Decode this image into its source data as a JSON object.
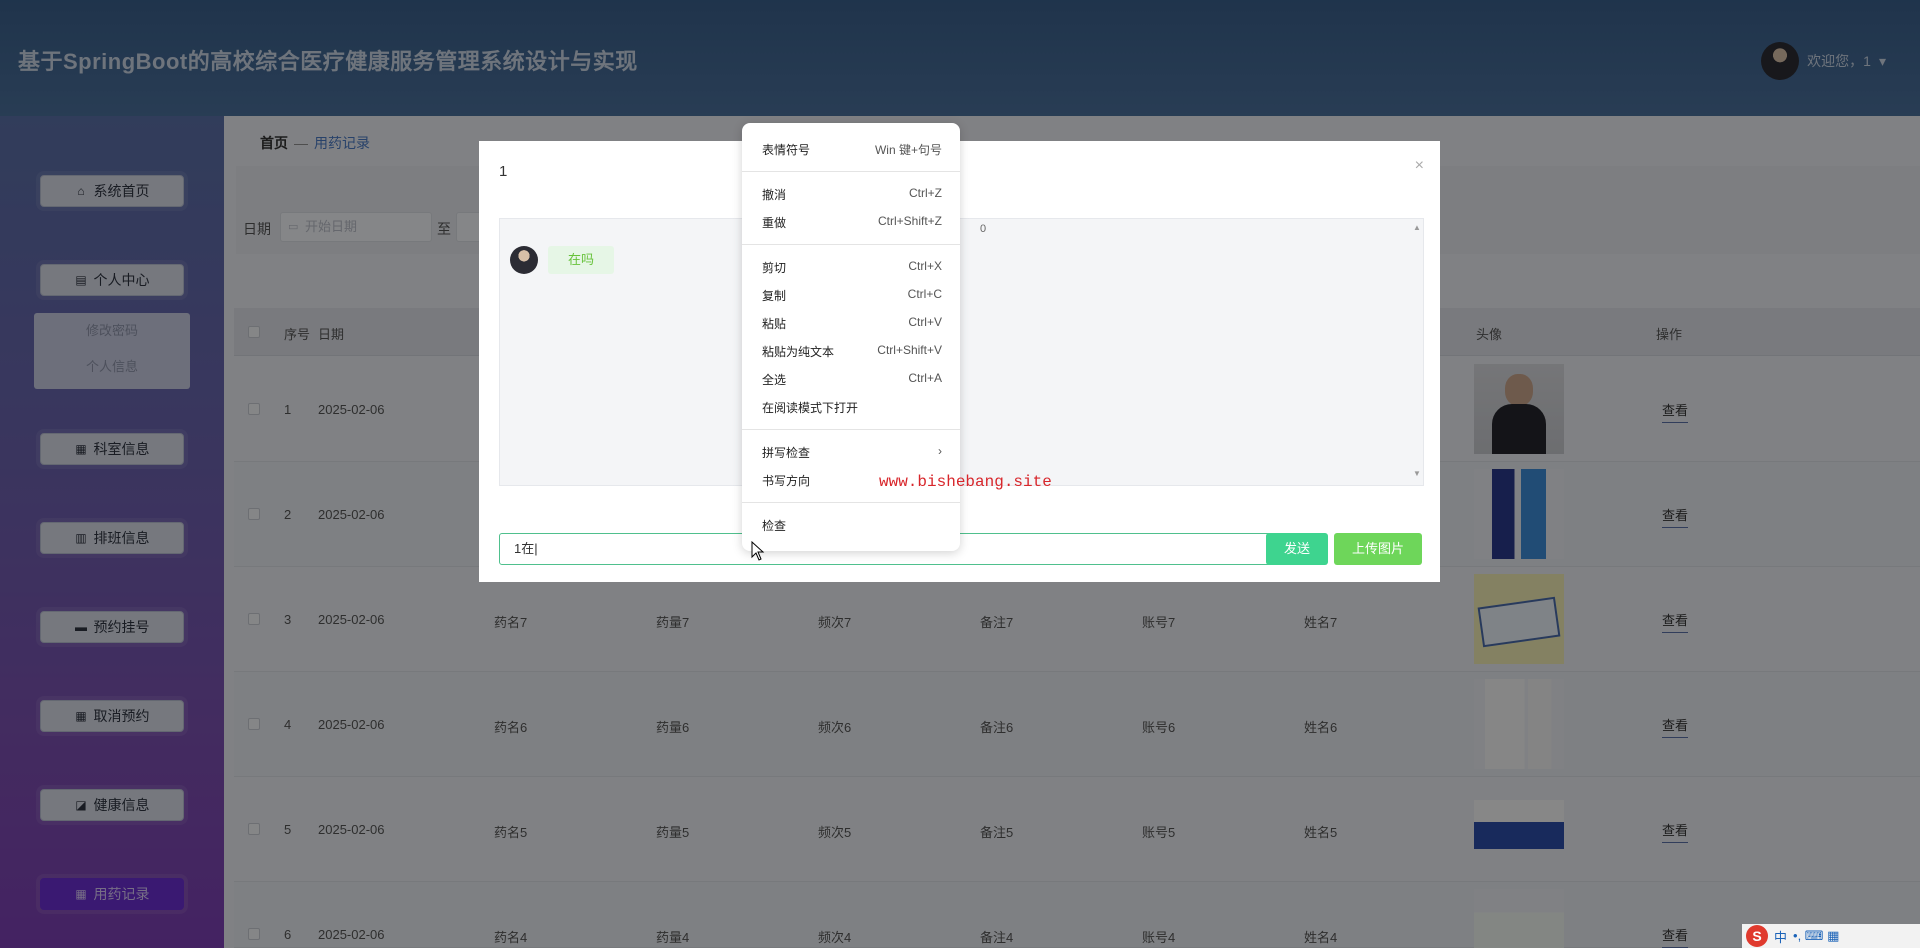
{
  "header": {
    "title": "基于SpringBoot的高校综合医疗健康服务管理系统设计与实现",
    "welcome": "欢迎您，1",
    "dropdown_icon": "▾"
  },
  "sidebar": {
    "items": [
      {
        "label": "系统首页",
        "icon": "⌂"
      },
      {
        "label": "个人中心",
        "icon": "▤"
      },
      {
        "label": "科室信息",
        "icon": "▦"
      },
      {
        "label": "排班信息",
        "icon": "▥"
      },
      {
        "label": "预约挂号",
        "icon": "▬"
      },
      {
        "label": "取消预约",
        "icon": "▦"
      },
      {
        "label": "健康信息",
        "icon": "◪"
      },
      {
        "label": "用药记录",
        "icon": "▦"
      }
    ],
    "submenu": [
      "修改密码",
      "个人信息"
    ]
  },
  "breadcrumb": {
    "home": "首页",
    "sep": "—",
    "current": "用药记录"
  },
  "search": {
    "date_label": "日期",
    "date_placeholder": "开始日期",
    "to_label": "至"
  },
  "table": {
    "headers": {
      "index": "序号",
      "date": "日期",
      "avatar": "头像",
      "action": "操作"
    },
    "rows": [
      {
        "index": "1",
        "date": "2025-02-06",
        "name": "",
        "dose": "",
        "freq": "",
        "note": "",
        "account": "",
        "person": ""
      },
      {
        "index": "2",
        "date": "2025-02-06",
        "name": "",
        "dose": "",
        "freq": "",
        "note": "",
        "account": "",
        "person": ""
      },
      {
        "index": "3",
        "date": "2025-02-06",
        "name": "药名7",
        "dose": "药量7",
        "freq": "频次7",
        "note": "备注7",
        "account": "账号7",
        "person": "姓名7"
      },
      {
        "index": "4",
        "date": "2025-02-06",
        "name": "药名6",
        "dose": "药量6",
        "freq": "频次6",
        "note": "备注6",
        "account": "账号6",
        "person": "姓名6"
      },
      {
        "index": "5",
        "date": "2025-02-06",
        "name": "药名5",
        "dose": "药量5",
        "freq": "频次5",
        "note": "备注5",
        "account": "账号5",
        "person": "姓名5"
      },
      {
        "index": "6",
        "date": "2025-02-06",
        "name": "药名4",
        "dose": "药量4",
        "freq": "频次4",
        "note": "备注4",
        "account": "账号4",
        "person": "姓名4"
      }
    ],
    "view_label": "查看"
  },
  "dialog": {
    "title": "1",
    "close": "×",
    "chat_message": "在吗",
    "stray_text": "0",
    "input_value": "1在|",
    "send_label": "发送",
    "upload_label": "上传图片"
  },
  "context_menu": [
    {
      "label": "表情符号",
      "key": "Win 键+句号"
    },
    {
      "label": "撤消",
      "key": "Ctrl+Z"
    },
    {
      "label": "重做",
      "key": "Ctrl+Shift+Z"
    },
    {
      "label": "剪切",
      "key": "Ctrl+X"
    },
    {
      "label": "复制",
      "key": "Ctrl+C"
    },
    {
      "label": "粘贴",
      "key": "Ctrl+V"
    },
    {
      "label": "粘贴为纯文本",
      "key": "Ctrl+Shift+V"
    },
    {
      "label": "全选",
      "key": "Ctrl+A"
    },
    {
      "label": "在阅读模式下打开",
      "key": ""
    },
    {
      "label": "拼写检查",
      "key": "›"
    },
    {
      "label": "书写方向",
      "key": ""
    },
    {
      "label": "检查",
      "key": ""
    }
  ],
  "watermark": "www.bishebang.site",
  "ime": {
    "logo": "S",
    "lang": "中",
    "extras": "•, ⌨ ▦"
  },
  "colors": {
    "accent": "#6b2fd0",
    "send": "#3ed48f",
    "upload": "#6ed65a",
    "watermark": "#d8262b"
  }
}
